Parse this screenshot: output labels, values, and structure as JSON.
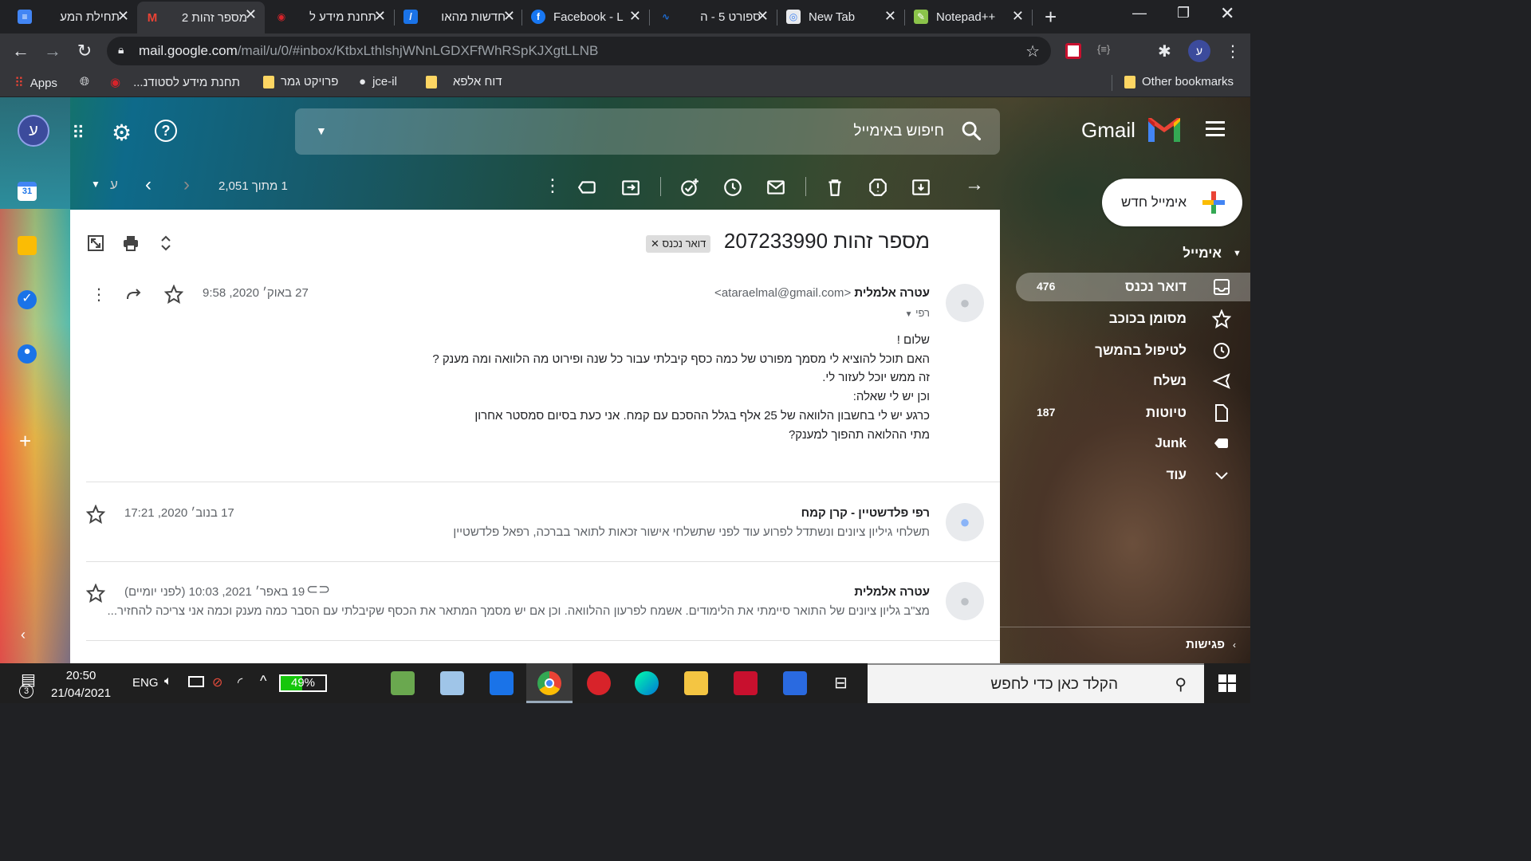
{
  "browser": {
    "tabs": [
      {
        "title": "תחילת המע",
        "active": false
      },
      {
        "title": "מספר זהות 2",
        "active": true
      },
      {
        "title": "תחנת מידע ל",
        "active": false
      },
      {
        "title": "חדשות מהאו",
        "active": false
      },
      {
        "title": "Facebook - L",
        "active": false
      },
      {
        "title": "ספורט 5 - ה",
        "active": false
      },
      {
        "title": "New Tab",
        "active": false
      },
      {
        "title": "Notepad++",
        "active": false
      }
    ],
    "url_host": "mail.google.com",
    "url_path": "/mail/u/0/#inbox/KtbxLthlshjWNnLGDXFfWhRSpKJXgtLLNB",
    "profile_initial": "ע",
    "bookmarks": {
      "apps": "Apps",
      "items": [
        "תחנת מידע לסטודנ...",
        "פרויקט גמר",
        "jce-il",
        "דוח אלפא"
      ],
      "other": "Other bookmarks"
    }
  },
  "gmail": {
    "logo_text": "Gmail",
    "search_placeholder": "חיפוש באימייל",
    "account_initial": "ע",
    "compose_label": "אימייל חדש",
    "section_mail": "אימייל",
    "nav": [
      {
        "label": "דואר נכנס",
        "count": "476",
        "icon": "inbox-icon",
        "active": true
      },
      {
        "label": "מסומן בכוכב",
        "count": "",
        "icon": "star-icon",
        "active": false
      },
      {
        "label": "לטיפול בהמשך",
        "count": "",
        "icon": "clock-icon",
        "active": false
      },
      {
        "label": "נשלח",
        "count": "",
        "icon": "send-icon",
        "active": false
      },
      {
        "label": "טיוטות",
        "count": "187",
        "icon": "draft-icon",
        "active": false
      },
      {
        "label": "Junk",
        "count": "",
        "icon": "label-icon",
        "active": false
      },
      {
        "label": "עוד",
        "count": "",
        "icon": "chevron-down-icon",
        "active": false
      }
    ],
    "meet_label": "פגישות",
    "pager": "1 מתוך 2,051",
    "pager_lang": "ע",
    "thread": {
      "subject": "מספר זהות 207233990",
      "label_chip": "דואר נכנס",
      "messages": [
        {
          "sender_name": "עטרה אלמלית",
          "sender_email": "<ataraelmal@gmail.com>",
          "to": "רפי",
          "date": "27 באוק׳ 2020, 9:58",
          "body": [
            "שלום !",
            "האם תוכל להוציא לי מסמך מפורט של כמה כסף קיבלתי עבור כל שנה  ופירוט מה הלוואה ומה מענק ?",
            "זה ממש יוכל לעזור לי.",
            "וכן יש לי שאלה:",
            "כרגע יש לי בחשבון הלוואה של 25 אלף בגלל ההסכם עם קמח. אני כעת בסיום סמסטר אחרון",
            "מתי ההלואה תהפוך למענק?"
          ]
        },
        {
          "sender_name": "רפי פלדשטיין - קרן קמח",
          "date": "17 בנוב׳ 2020, 17:21",
          "snippet": "תשלחי גיליון ציונים ונשתדל לפרוע עוד לפני שתשלחי אישור זכאות לתואר בברכה, רפאל פלדשטיין"
        },
        {
          "sender_name": "עטרה אלמלית",
          "date": "19 באפר׳ 2021, 10:03 (לפני יומיים)",
          "snippet": "מצ\"ב גליון ציונים של התואר סיימתי את הלימודים. אשמח לפרעון ההלוואה. וכן אם יש מסמך המתאר את הכסף שקיבלתי עם הסבר כמה מענק וכמה אני צריכה להחזיר..."
        }
      ]
    }
  },
  "taskbar": {
    "search_placeholder": "הקלד כאן כדי לחפש",
    "time": "20:50",
    "date": "21/04/2021",
    "lang": "ENG",
    "battery": "49%",
    "battery_level": 0.49,
    "notifications": "3"
  }
}
